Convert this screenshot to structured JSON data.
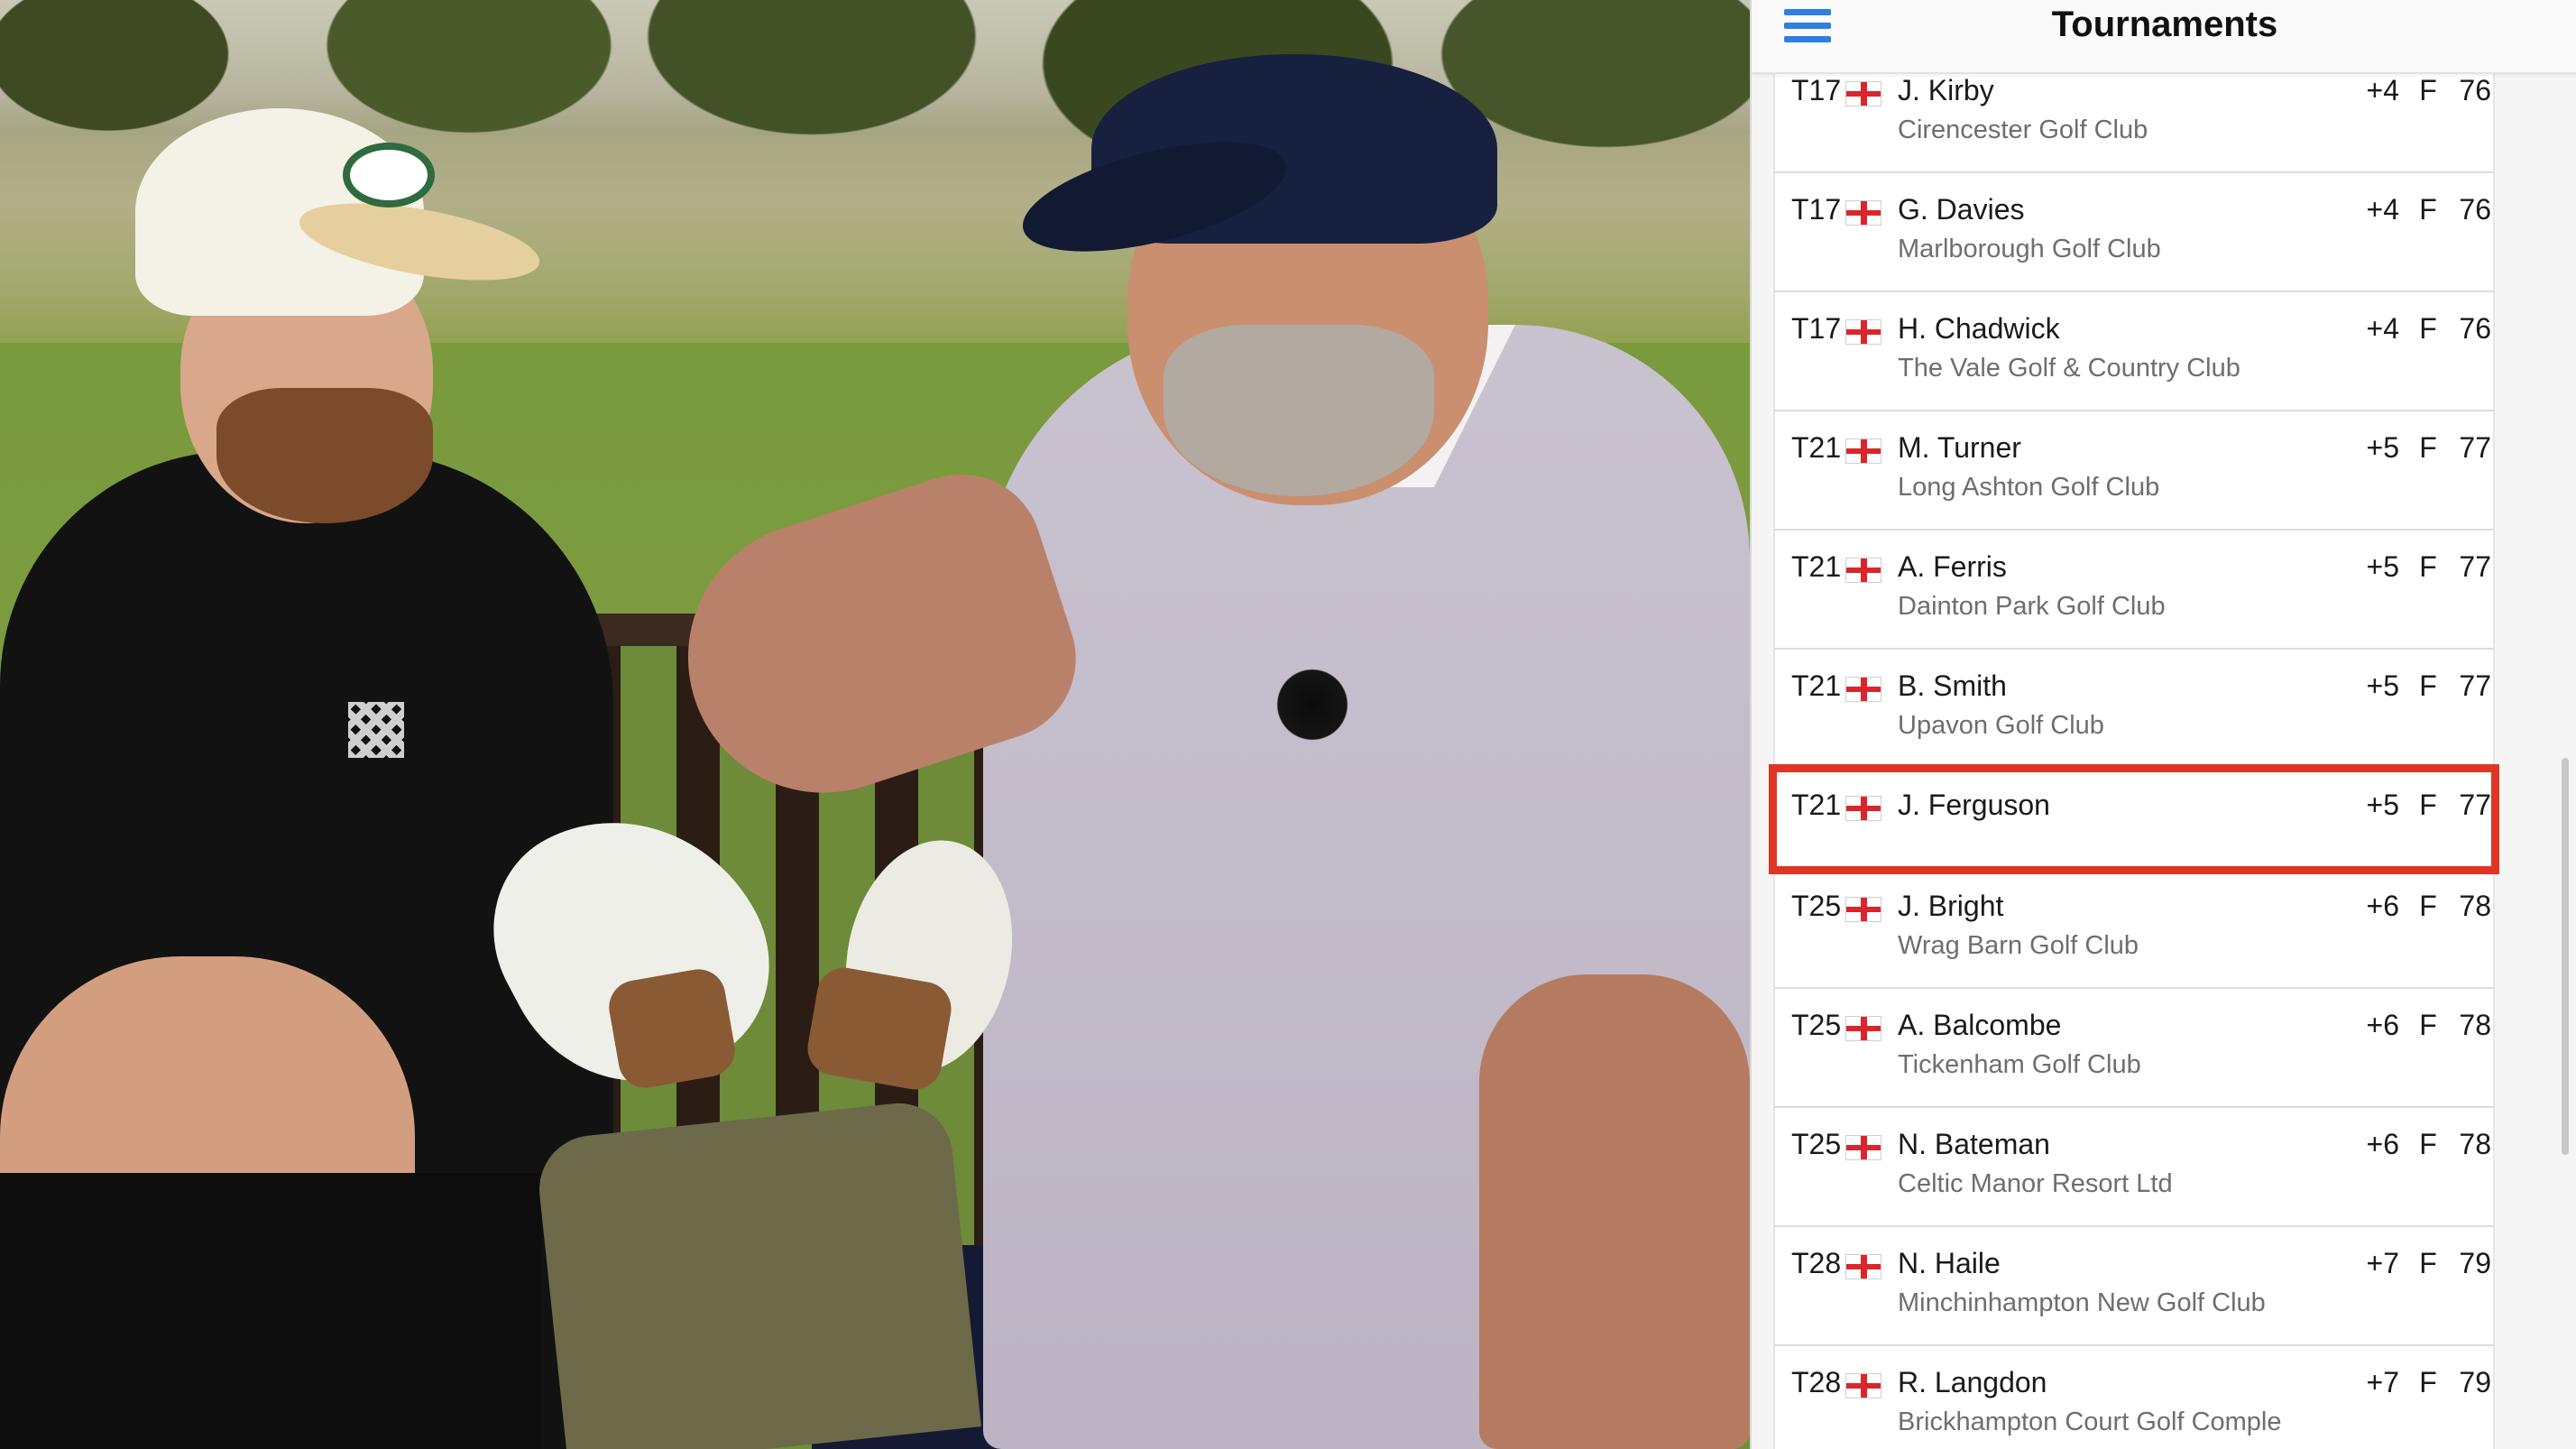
{
  "panel": {
    "title": "Tournaments",
    "menu_icon": "hamburger-menu-icon",
    "rows": [
      {
        "pos": "T17",
        "name": "J. Kirby",
        "club": "Cirencester Golf Club",
        "to_par": "+4",
        "thru": "F",
        "score": "76",
        "flag": "england-flag-icon"
      },
      {
        "pos": "T17",
        "name": "G. Davies",
        "club": "Marlborough Golf Club",
        "to_par": "+4",
        "thru": "F",
        "score": "76",
        "flag": "england-flag-icon"
      },
      {
        "pos": "T17",
        "name": "H. Chadwick",
        "club": "The Vale Golf & Country Club",
        "to_par": "+4",
        "thru": "F",
        "score": "76",
        "flag": "england-flag-icon"
      },
      {
        "pos": "T21",
        "name": "M. Turner",
        "club": "Long Ashton Golf Club",
        "to_par": "+5",
        "thru": "F",
        "score": "77",
        "flag": "england-flag-icon"
      },
      {
        "pos": "T21",
        "name": "A. Ferris",
        "club": "Dainton Park Golf Club",
        "to_par": "+5",
        "thru": "F",
        "score": "77",
        "flag": "england-flag-icon"
      },
      {
        "pos": "T21",
        "name": "B. Smith",
        "club": "Upavon Golf Club",
        "to_par": "+5",
        "thru": "F",
        "score": "77",
        "flag": "england-flag-icon"
      },
      {
        "pos": "T21",
        "name": "J. Ferguson",
        "club": "",
        "to_par": "+5",
        "thru": "F",
        "score": "77",
        "flag": "england-flag-icon",
        "highlighted": true
      },
      {
        "pos": "T25",
        "name": "J. Bright",
        "club": "Wrag Barn Golf Club",
        "to_par": "+6",
        "thru": "F",
        "score": "78",
        "flag": "england-flag-icon"
      },
      {
        "pos": "T25",
        "name": "A. Balcombe",
        "club": "Tickenham Golf Club",
        "to_par": "+6",
        "thru": "F",
        "score": "78",
        "flag": "england-flag-icon"
      },
      {
        "pos": "T25",
        "name": "N. Bateman",
        "club": "Celtic Manor Resort Ltd",
        "to_par": "+6",
        "thru": "F",
        "score": "78",
        "flag": "england-flag-icon"
      },
      {
        "pos": "T28",
        "name": "N. Haile",
        "club": "Minchinhampton New Golf Club",
        "to_par": "+7",
        "thru": "F",
        "score": "79",
        "flag": "england-flag-icon"
      },
      {
        "pos": "T28",
        "name": "R. Langdon",
        "club": "Brickhampton Court Golf Comple",
        "to_par": "+7",
        "thru": "F",
        "score": "79",
        "flag": "england-flag-icon"
      }
    ]
  },
  "colors": {
    "highlight": "#e03526",
    "menu_accent": "#2f7fe0",
    "flag_red": "#d9262c"
  }
}
